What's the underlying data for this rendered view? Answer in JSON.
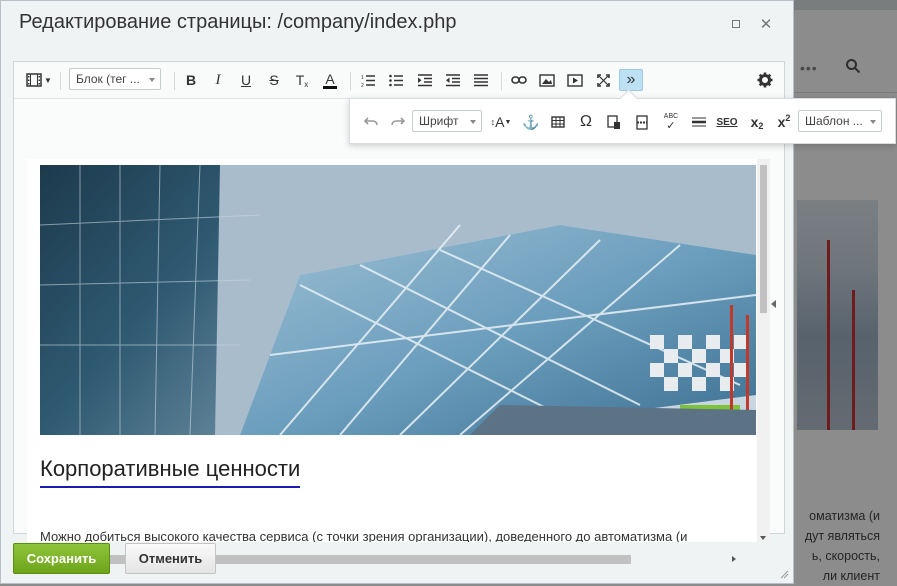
{
  "dialog": {
    "title": "Редактирование страницы: /company/index.php",
    "save_label": "Сохранить",
    "cancel_label": "Отменить"
  },
  "toolbar": {
    "block_select": "Блок (тег ...",
    "bold": "B",
    "italic": "I",
    "underline": "U",
    "strike": "S",
    "remove_format": "T",
    "font_color": "A",
    "more": "»"
  },
  "sub_toolbar": {
    "font_select": "Шрифт",
    "font_size": "A",
    "special_char": "Ω",
    "spellcheck": "ABC",
    "seo": "SEO",
    "subscript": "x",
    "superscript": "x",
    "template_select": "Шаблон ..."
  },
  "content": {
    "heading": "Корпоративные ценности",
    "paragraph": "Можно добиться высокого качества сервиса (с точки зрения организации), доведенного до автоматизма (и"
  },
  "background_page": {
    "text_lines": [
      "оматизма (и",
      "дут являться",
      "ь, скорость,",
      "ли клиент"
    ]
  },
  "colors": {
    "save_green": "#7ab32a",
    "heading_underline": "#1d1ab0",
    "active_toolbar": "#bde0f3"
  }
}
